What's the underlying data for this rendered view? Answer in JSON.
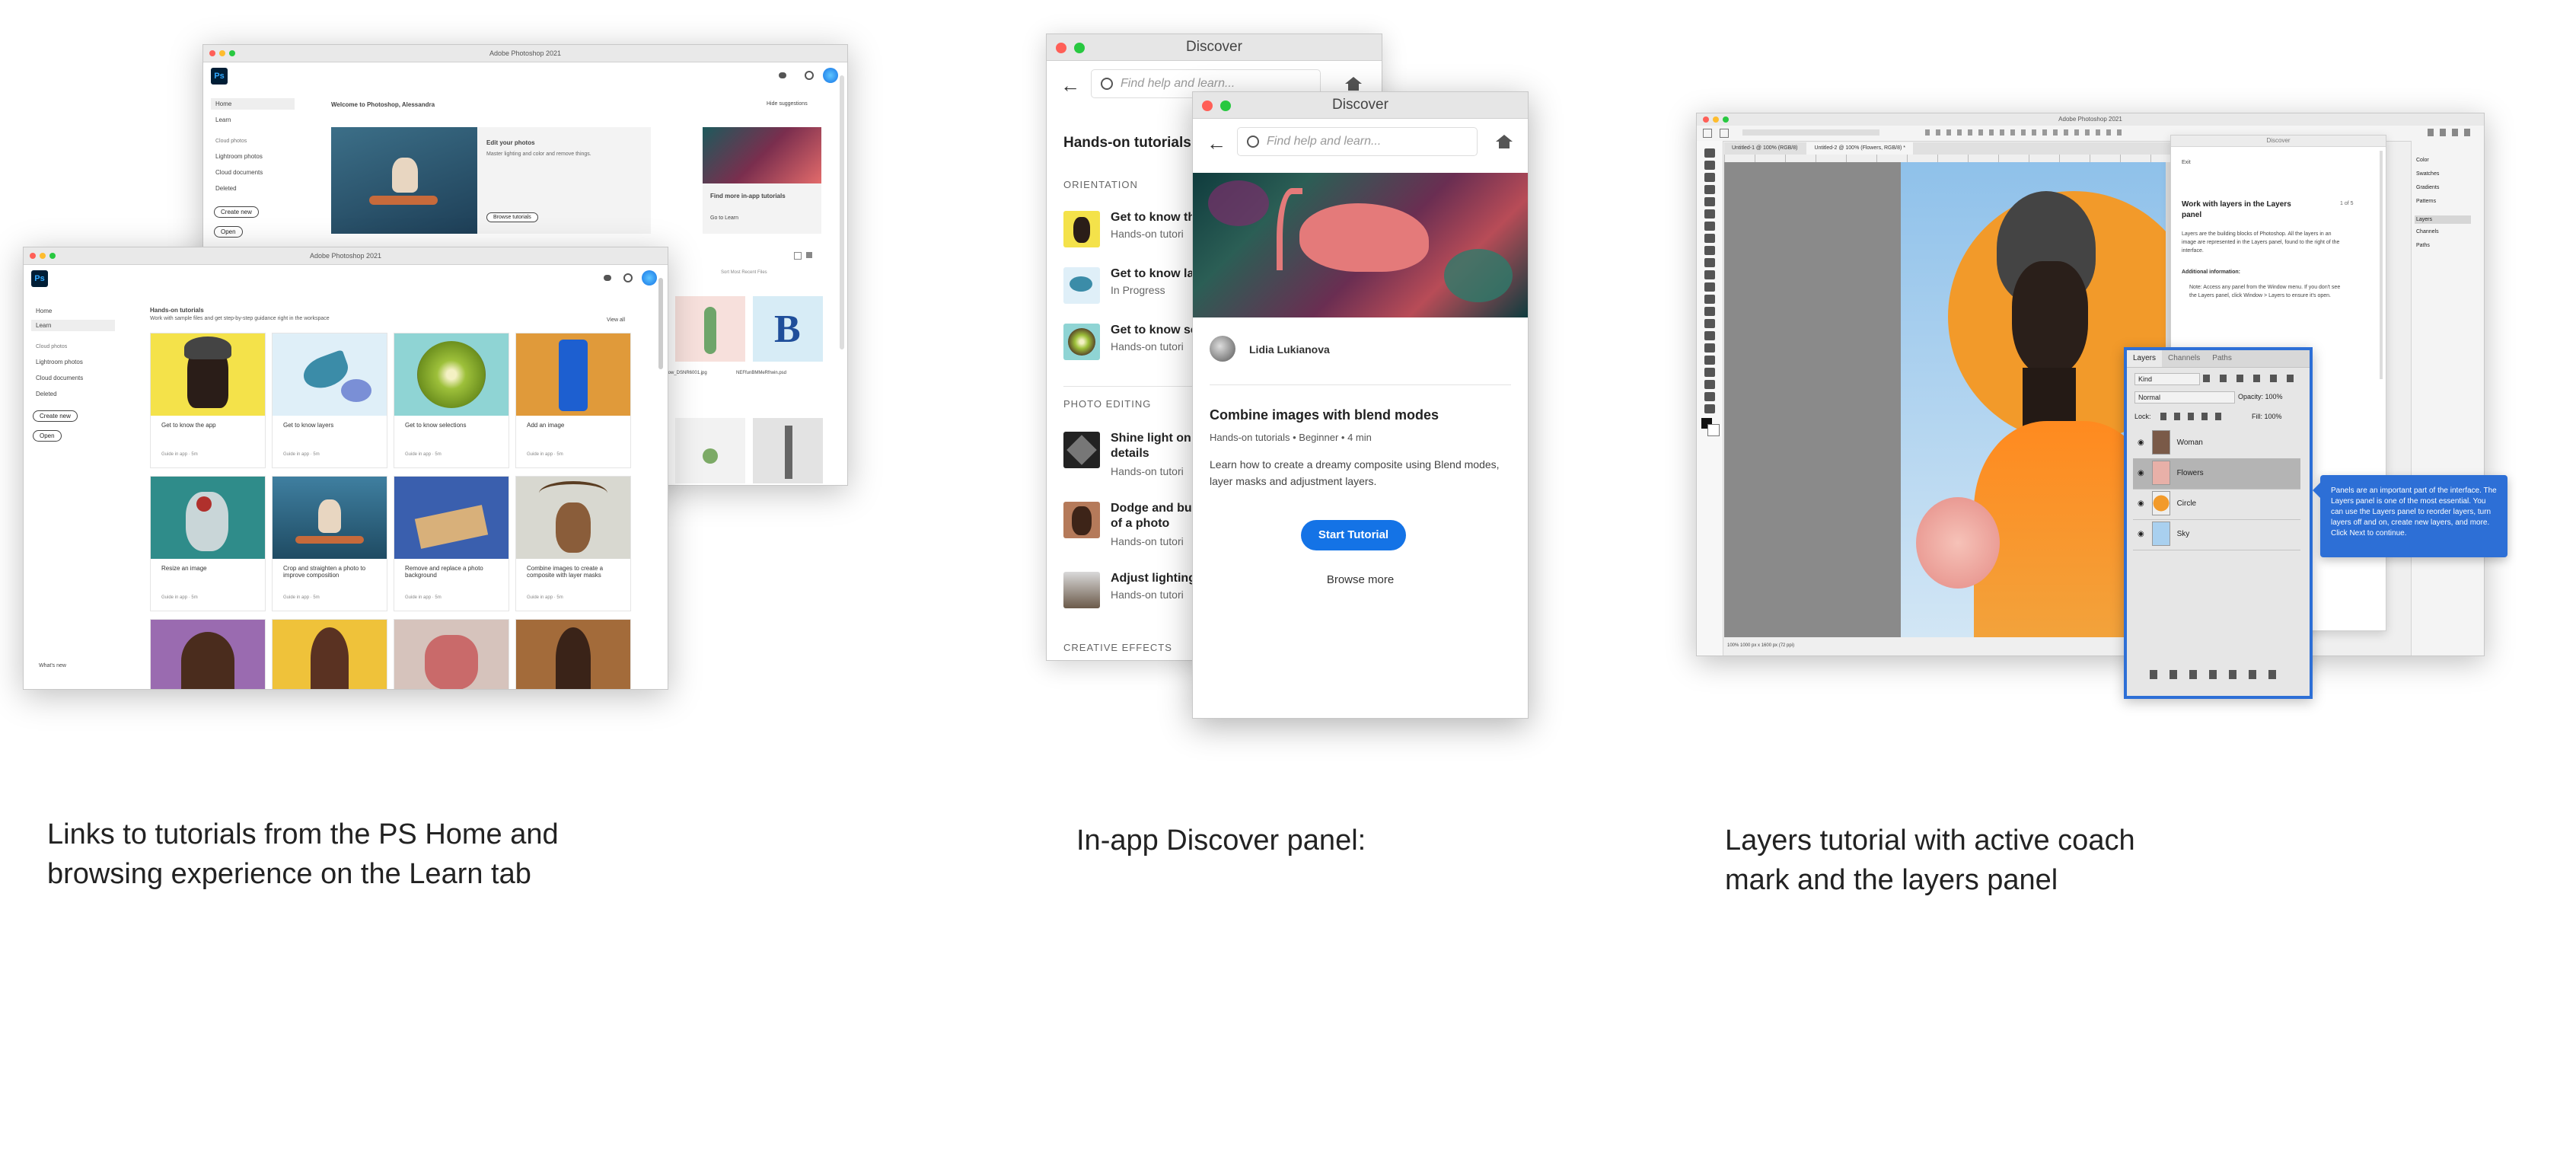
{
  "captions": {
    "home": "Links to tutorials from the PS Home and browsing experience on the Learn tab",
    "discover": "In-app Discover panel:",
    "layers": "Layers tutorial with active coach mark and the layers panel"
  },
  "home_back": {
    "title": "Adobe Photoshop 2021",
    "welcome": "Welcome to Photoshop, Alessandra",
    "hide_suggestions": "Hide suggestions",
    "sidebar": [
      "Home",
      "Learn",
      "Cloud photos",
      "Lightroom photos",
      "Cloud documents",
      "Deleted"
    ],
    "create_new": "Create new",
    "open": "Open",
    "edit_title": "Edit your photos",
    "edit_sub": "Master lighting and color and remove things.",
    "browse_tutorials": "Browse tutorials",
    "find_more": "Find more in-app tutorials",
    "go_to_learn": "Go to Learn",
    "sort": "Sort  Most Recent Files",
    "file1": "sunflow_DSNR6001.jpg",
    "file2": "NEFfunBMMeRfrwin.psd"
  },
  "home_front": {
    "title": "Adobe Photoshop 2021",
    "sidebar": [
      "Home",
      "Learn",
      "Cloud photos",
      "Lightroom photos",
      "Cloud documents",
      "Deleted"
    ],
    "create_new": "Create new",
    "open": "Open",
    "whats_new": "What's new",
    "heading": "Hands-on tutorials",
    "subheading": "Work with sample files and get step-by-step guidance right in the workspace",
    "view_all": "View all",
    "row1": [
      {
        "title": "Get to know the app",
        "meta": "Guide in app · 5m"
      },
      {
        "title": "Get to know layers",
        "meta": "Guide in app · 5m"
      },
      {
        "title": "Get to know selections",
        "meta": "Guide in app · 5m"
      },
      {
        "title": "Add an image",
        "meta": "Guide in app · 5m"
      }
    ],
    "row2": [
      {
        "title": "Resize an image",
        "meta": "Guide in app · 5m"
      },
      {
        "title": "Crop and straighten a photo to improve composition",
        "meta": "Guide in app · 5m"
      },
      {
        "title": "Remove and replace a photo background",
        "meta": "Guide in app · 5m"
      },
      {
        "title": "Combine images to create a composite with layer masks",
        "meta": "Guide in app · 5m"
      }
    ]
  },
  "discover_back": {
    "title": "Discover",
    "search_placeholder": "Find help and learn...",
    "heading": "Hands-on tutorials",
    "orientation": "ORIENTATION",
    "photo_editing": "PHOTO EDITING",
    "creative_effects": "CREATIVE EFFECTS",
    "items": [
      {
        "title": "Get to know the",
        "sub": "Hands-on tutori"
      },
      {
        "title": "Get to know lay",
        "sub": "In Progress"
      },
      {
        "title": "Get to know sele",
        "sub": "Hands-on tutori"
      },
      {
        "title": "Shine light on a",
        "title2": "details",
        "sub": "Hands-on tutori"
      },
      {
        "title": "Dodge and burn",
        "title2": "of a photo",
        "sub": "Hands-on tutori"
      },
      {
        "title": "Adjust lighting i",
        "sub": "Hands-on tutori"
      }
    ]
  },
  "discover_front": {
    "title": "Discover",
    "search_placeholder": "Find help and learn...",
    "author": "Lidia Lukianova",
    "tutorial_title": "Combine images with blend modes",
    "tutorial_meta": "Hands-on tutorials  •  Beginner  •  4 min",
    "description": "Learn how to create a dreamy composite using Blend modes, layer masks and adjustment layers.",
    "start_button": "Start Tutorial",
    "browse_more": "Browse more"
  },
  "layers_shot": {
    "title": "Adobe Photoshop 2021",
    "doc_tab1": "Untitled-1 @ 100% (RGB/8)",
    "doc_tab2": "Untitled-2 @ 100% (Flowers, RGB/8) *",
    "discover_title": "Discover",
    "exit": "Exit",
    "panel_heading": "Work with layers in the Layers panel",
    "step": "1 of 5",
    "panel_body": "Layers are the building blocks of Photoshop. All the layers in an image are represented in the Layers panel, found to the right of the interface.",
    "additional": "Additional information:",
    "note": "Note: Access any panel from the Window menu. If you don't see the Layers panel, click Window > Layers to ensure it's open.",
    "right_panels": [
      "Color",
      "Swatches",
      "Gradients",
      "Patterns",
      "Layers",
      "Channels",
      "Paths"
    ],
    "tabs": [
      "Layers",
      "Channels",
      "Paths"
    ],
    "kind": "Kind",
    "blend": "Normal",
    "opacity": "Opacity: 100%",
    "lock": "Lock:",
    "fill": "Fill: 100%",
    "layers": [
      "Woman",
      "Flowers",
      "Circle",
      "Sky"
    ],
    "coach": "Panels are an important part of the interface. The Layers panel is one of the most essential. You can use the Layers panel to reorder layers, turn layers off and on, create new layers, and more. Click Next to continue.",
    "status": "100%     1000 px x 1600 px (72 ppi)"
  },
  "colors": {
    "accent": "#1473e6",
    "coach": "#2d6fd6",
    "ps_dark": "#001e36"
  }
}
